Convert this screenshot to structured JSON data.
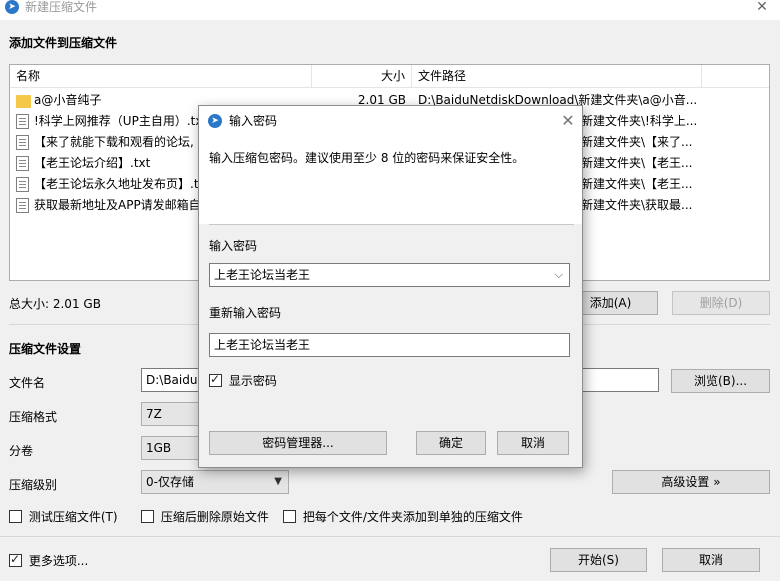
{
  "window": {
    "title": "新建压缩文件",
    "close_glyph": "✕",
    "app_icon_glyph": "➤"
  },
  "add_files": {
    "section_title": "添加文件到压缩文件",
    "columns": [
      "名称",
      "大小",
      "文件路径"
    ],
    "rows": [
      {
        "icon": "folder-icon",
        "name": "a@小音纯子",
        "size": "2.01 GB",
        "path": "D:\\BaiduNetdiskDownload\\新建文件夹\\a@小音..."
      },
      {
        "icon": "file-icon",
        "name": "!科学上网推荐（UP主自用）.txt",
        "size": "",
        "path": "新建文件夹\\!科学上..."
      },
      {
        "icon": "file-icon",
        "name": "【来了就能下载和观看的论坛,",
        "size": "",
        "path": "新建文件夹\\【来了..."
      },
      {
        "icon": "file-icon",
        "name": "【老王论坛介绍】.txt",
        "size": "",
        "path": "新建文件夹\\【老王..."
      },
      {
        "icon": "file-icon",
        "name": "【老王论坛永久地址发布页】.tx",
        "size": "",
        "path": "新建文件夹\\【老王..."
      },
      {
        "icon": "file-icon",
        "name": "获取最新地址及APP请发邮箱自",
        "size": "",
        "path": "新建文件夹\\获取最..."
      }
    ],
    "total_size": "总大小: 2.01 GB",
    "add_button": "添加(A)",
    "delete_button": "删除(D)"
  },
  "settings": {
    "section_title": "压缩文件设置",
    "filename_label": "文件名",
    "filename_value": "D:\\BaiduN",
    "browse_button": "浏览(B)...",
    "format_label": "压缩格式",
    "format_value": "7Z",
    "split_label": "分卷",
    "split_value": "1GB",
    "level_label": "压缩级别",
    "level_value": "0-仅存储",
    "advanced_button": "高级设置 »",
    "test_checkbox": "测试压缩文件(T)",
    "delete_after_checkbox": "压缩后删除原始文件",
    "separate_checkbox": "把每个文件/文件夹添加到单独的压缩文件"
  },
  "footer": {
    "more_options": "更多选项...",
    "start_button": "开始(S)",
    "cancel_button": "取消"
  },
  "dialog": {
    "title": "输入密码",
    "close_glyph": "✕",
    "message": "输入压缩包密码。建议使用至少 8 位的密码来保证安全性。",
    "password_label": "输入密码",
    "password_value": "上老王论坛当老王",
    "reenter_label": "重新输入密码",
    "reenter_value": "上老王论坛当老王",
    "show_password": "显示密码",
    "manager_button": "密码管理器...",
    "ok_button": "确定",
    "cancel_button": "取消"
  }
}
